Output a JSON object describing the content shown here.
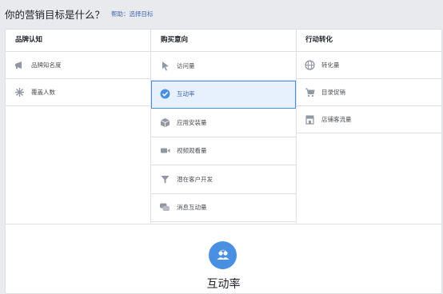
{
  "header": {
    "title": "你的营销目标是什么？",
    "help": "帮助：选择目标"
  },
  "columns": [
    {
      "title": "品牌认知",
      "items": [
        {
          "label": "品牌知名度",
          "icon": "megaphone-icon"
        },
        {
          "label": "覆盖人数",
          "icon": "snowflake-icon"
        }
      ]
    },
    {
      "title": "购买意向",
      "items": [
        {
          "label": "访问量",
          "icon": "cursor-icon"
        },
        {
          "label": "互动率",
          "icon": "check-circle-icon",
          "selected": true
        },
        {
          "label": "应用安装量",
          "icon": "cube-icon"
        },
        {
          "label": "视频观看量",
          "icon": "video-camera-icon"
        },
        {
          "label": "潜在客户开发",
          "icon": "funnel-icon"
        },
        {
          "label": "消息互动量",
          "icon": "chat-bubbles-icon"
        }
      ]
    },
    {
      "title": "行动转化",
      "items": [
        {
          "label": "转化量",
          "icon": "globe-icon"
        },
        {
          "label": "目录促销",
          "icon": "shopping-cart-icon"
        },
        {
          "label": "店铺客流量",
          "icon": "store-icon"
        }
      ]
    }
  ],
  "selected": {
    "label": "互动率",
    "icon": "people-icon"
  },
  "colors": {
    "accent": "#4a90e2",
    "link": "#4267b2",
    "selected_bg": "#e7f0fd",
    "border": "#dddfe2",
    "icon_gray": "#9197a3"
  }
}
